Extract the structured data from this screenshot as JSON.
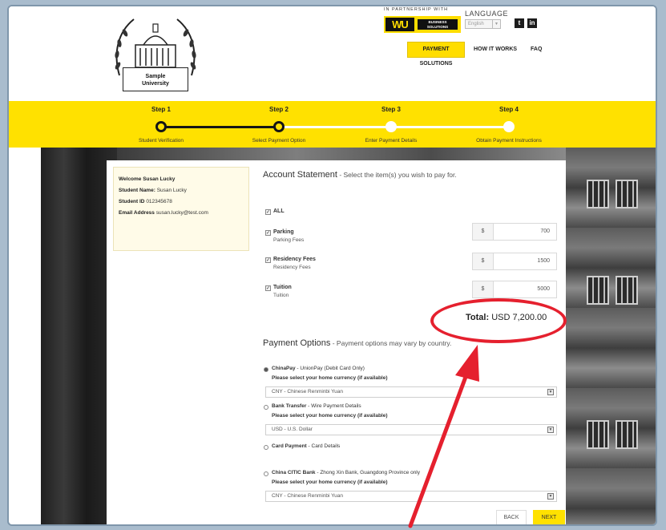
{
  "header": {
    "university_name": "Sample\nUniversity",
    "partner_text": "IN PARTNERSHIP WITH",
    "wu_letters": "WU",
    "wu_business": "BUSINESS\nSOLUTIONS",
    "language_label": "LANGUAGE",
    "language_value": "English",
    "nav": {
      "payment_solutions": "PAYMENT SOLUTIONS",
      "how_it_works": "HOW IT WORKS",
      "faq": "FAQ"
    }
  },
  "steps": [
    {
      "title": "Step 1",
      "label": "Student Verification",
      "done": true
    },
    {
      "title": "Step 2",
      "label": "Select Payment Option",
      "done": true
    },
    {
      "title": "Step 3",
      "label": "Enter Payment Details",
      "done": false
    },
    {
      "title": "Step 4",
      "label": "Obtain Payment Instructions",
      "done": false
    }
  ],
  "welcome": {
    "greeting": "Welcome Susan Lucky",
    "name_label": "Student Name:",
    "name_value": "Susan Lucky",
    "id_label": "Student ID",
    "id_value": "012345678",
    "email_label": "Email Address",
    "email_value": "susan.lucky@test.com"
  },
  "account": {
    "title": "Account Statement",
    "subtitle": " - Select the item(s) you wish to pay for.",
    "all_label": "ALL",
    "currency_symbol": "$",
    "items": [
      {
        "label": "Parking",
        "sub": "Parking Fees",
        "amount": "700"
      },
      {
        "label": "Residency Fees",
        "sub": "Residency Fees",
        "amount": "1500"
      },
      {
        "label": "Tuition",
        "sub": "Tuition",
        "amount": "5000"
      }
    ],
    "total_label": "Total:",
    "total_value": "USD 7,200.00"
  },
  "payment": {
    "title": "Payment Options",
    "subtitle": " - Payment options may vary by country.",
    "currency_hint": "Please select your home currency (if available)",
    "options": [
      {
        "name": "ChinaPay",
        "desc": " - UnionPay (Debit Card Only)",
        "selected": true,
        "currency": "CNY - Chinese Renminbi Yuan"
      },
      {
        "name": "Bank Transfer",
        "desc": " - Wire Payment Details",
        "selected": false,
        "currency": "USD - U.S. Dollar"
      },
      {
        "name": "Card Payment",
        "desc": " - Card Details",
        "selected": false,
        "currency": ""
      },
      {
        "name": "China CITIC Bank",
        "desc": " - Zhong Xin Bank, Guangdong Province only",
        "selected": false,
        "currency": "CNY - Chinese Renminbi Yuan"
      }
    ]
  },
  "buttons": {
    "back": "BACK",
    "next": "NEXT"
  },
  "colors": {
    "brand_yellow": "#ffe100",
    "annotation_red": "#e5202e"
  }
}
